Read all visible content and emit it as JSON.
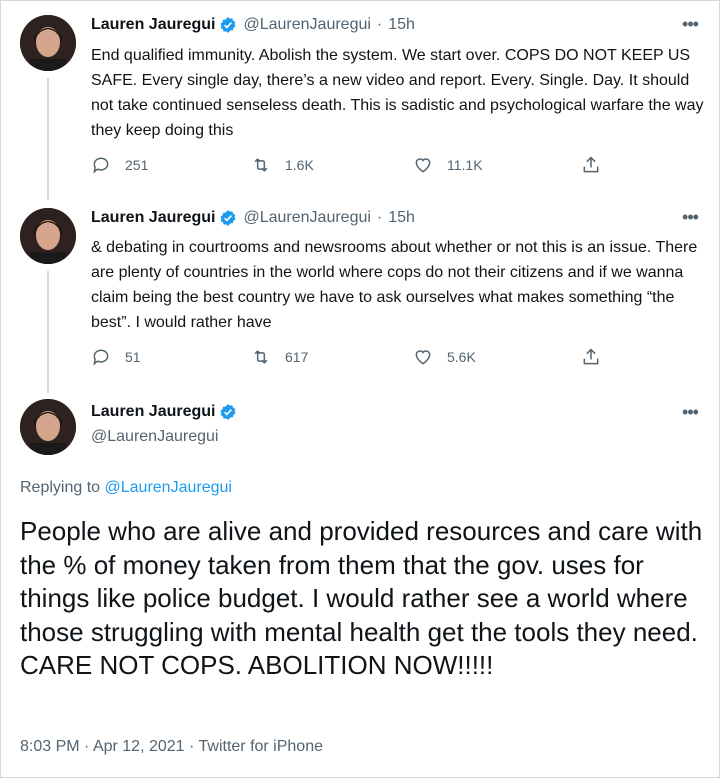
{
  "tweets": [
    {
      "name": "Lauren Jauregui",
      "handle": "@LaurenJauregui",
      "sep": "·",
      "time": "15h",
      "more": "•••",
      "text": "End qualified immunity. Abolish the system. We start over. COPS DO NOT KEEP US SAFE. Every single day, there’s a new video and report. Every. Single. Day. It should not take continued senseless death. This is sadistic and psychological warfare the way they keep doing this",
      "replies": "251",
      "retweets": "1.6K",
      "likes": "11.1K"
    },
    {
      "name": "Lauren Jauregui",
      "handle": "@LaurenJauregui",
      "sep": "·",
      "time": "15h",
      "more": "•••",
      "text": "& debating in courtrooms and newsrooms about whether or not this is an issue. There are plenty of countries in the world where cops do not their citizens and if we wanna claim being the best country we have to ask ourselves what makes something “the best”. I would rather have",
      "replies": "51",
      "retweets": "617",
      "likes": "5.6K"
    }
  ],
  "main_tweet": {
    "name": "Lauren Jauregui",
    "handle": "@LaurenJauregui",
    "more": "•••",
    "replying_prefix": "Replying to",
    "replying_handle": "@LaurenJauregui",
    "text": "People who are alive and provided resources and care with the % of money taken from them that the gov. uses for things like police budget. I would rather see a world where those struggling with mental health get the tools they need. CARE NOT COPS. ABOLITION NOW!!!!!",
    "time": "8:03 PM",
    "date": "Apr 12, 2021",
    "source": "Twitter for iPhone",
    "sep": "·"
  },
  "colors": {
    "text": "#0f1419",
    "secondary": "#536471",
    "accent": "#1d9bf0",
    "border": "#cfd9de"
  },
  "icons": [
    "verified-badge-icon",
    "reply-icon",
    "retweet-icon",
    "like-icon",
    "share-icon",
    "more-icon"
  ]
}
